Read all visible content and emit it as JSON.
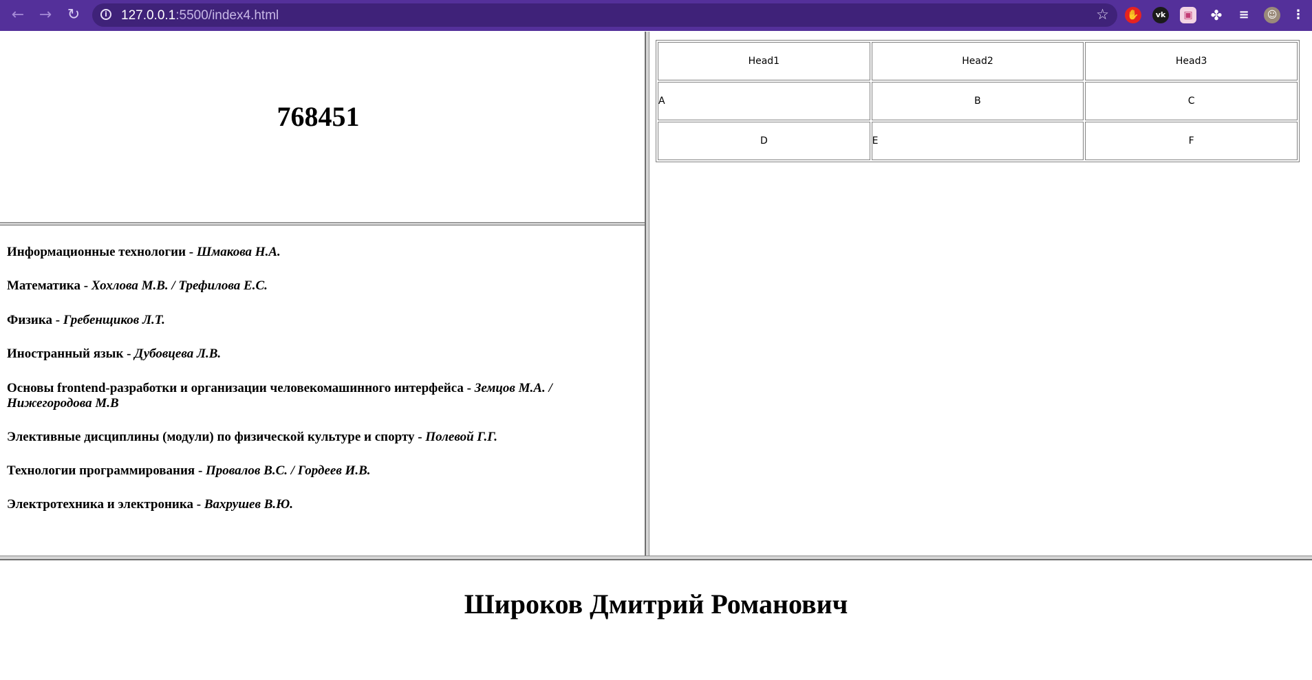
{
  "browser": {
    "url_host": "127.0.0.1",
    "url_rest": ":5500/index4.html"
  },
  "top_left": {
    "number": "768451"
  },
  "subjects": [
    {
      "name": "Информационные технологии",
      "separator": " - ",
      "teacher": "Шмакова Н.А."
    },
    {
      "name": "Математика",
      "separator": " - ",
      "teacher": "Хохлова М.В. / Трефилова Е.С."
    },
    {
      "name": "Физика",
      "separator": " - ",
      "teacher": "Гребенщиков Л.Т."
    },
    {
      "name": "Иностранный язык",
      "separator": " - ",
      "teacher": "Дубовцева Л.В."
    },
    {
      "name": "Основы frontend-разработки и организации человекомашинного интерфейса",
      "separator": " - ",
      "teacher": "Земцов М.А. / Нижегородова М.В"
    },
    {
      "name": "Элективные дисциплины (модули) по физической культуре и спорту",
      "separator": " - ",
      "teacher": "Полевой Г.Г."
    },
    {
      "name": "Технологии программирования",
      "separator": " - ",
      "teacher": "Провалов В.С. / Гордеев И.В."
    },
    {
      "name": "Электротехника и электроника",
      "separator": " - ",
      "teacher": "Вахрушев В.Ю."
    }
  ],
  "table": {
    "head": [
      "Head1",
      "Head2",
      "Head3"
    ],
    "rows": [
      [
        "A",
        "B",
        "C"
      ],
      [
        "D",
        "E",
        "F"
      ]
    ]
  },
  "footer": {
    "full_name": "Широков Дмитрий Романович"
  },
  "colors": {
    "toolbar": "#54309a",
    "omnibox": "#3f2279"
  }
}
